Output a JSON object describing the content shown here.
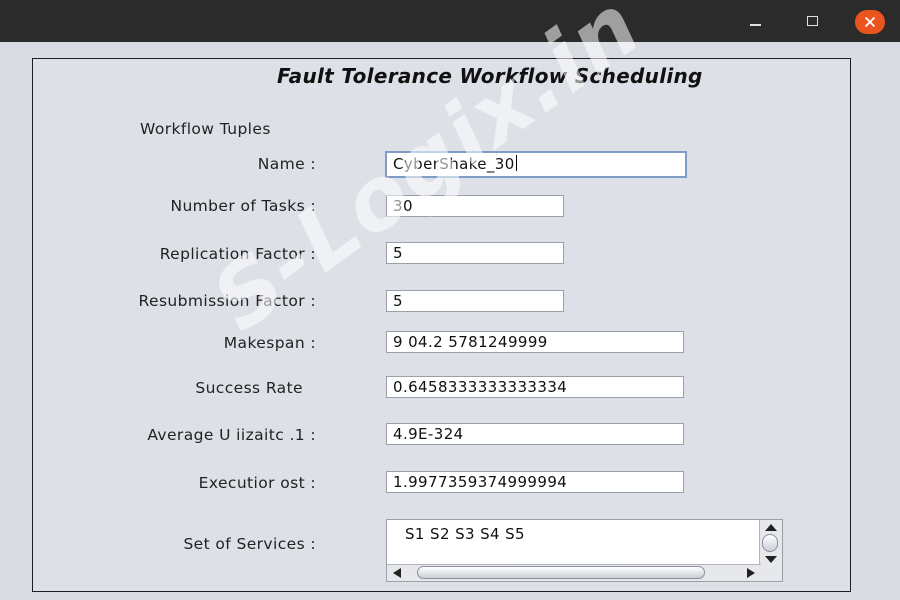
{
  "window": {
    "controls": {
      "minimize_icon": "minimize-icon",
      "maximize_icon": "maximize-icon",
      "close_icon": "close-icon",
      "close_color": "#e9541f"
    }
  },
  "app": {
    "title": "Fault Tolerance Workflow Scheduling",
    "section_label": "Workflow Tuples"
  },
  "form": {
    "name": {
      "label": "Name :",
      "value": "CyberShake_30"
    },
    "tasks": {
      "label": "Number of Tasks :",
      "value": "30"
    },
    "replication": {
      "label": "Replication Factor :",
      "value": "5"
    },
    "resubmission": {
      "label": "Resubmission Factor :",
      "value": "5"
    },
    "makespan": {
      "label": "Makespan :",
      "value": "9 04.2 5781249999"
    },
    "success_rate": {
      "label": "Success Rate",
      "value": "0.6458333333333334"
    },
    "utilization": {
      "label": "Average U iizaitc .1 :",
      "value": "4.9E-324"
    },
    "execution_cost": {
      "label": "Executior ost :",
      "value": "1.9977359374999994"
    },
    "services": {
      "label": "Set of Services :",
      "value": "S1 S2 S3 S4 S5"
    }
  },
  "watermark": {
    "text": "S-Logix.in"
  }
}
